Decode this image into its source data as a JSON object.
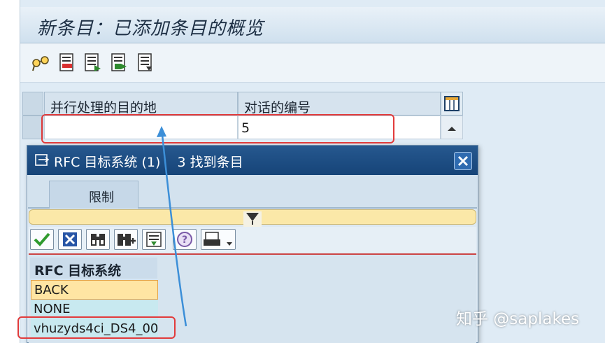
{
  "screen": {
    "title": "新条目：已添加条目的概览"
  },
  "toolbar": {
    "icons": [
      "glasses-icon",
      "list-red-icon",
      "list-delete-icon",
      "list-copy-icon",
      "list-detail-icon"
    ]
  },
  "table": {
    "columns": [
      "并行处理的目的地",
      "对话的编号"
    ],
    "rows": [
      {
        "destination": "",
        "dialog_count": "5"
      }
    ]
  },
  "popup": {
    "title": "RFC 目标系统 (1)    3 找到条目",
    "tab_label": "限制",
    "list_header": "RFC 目标系统",
    "items": [
      "BACK",
      "NONE",
      "vhuzyds4ci_DS4_00"
    ]
  },
  "watermark": "知乎 @saplakes",
  "colors": {
    "accent_red": "#e23b3b",
    "arrow_blue": "#3c8fd8",
    "title_blue": "#1d4f87"
  }
}
